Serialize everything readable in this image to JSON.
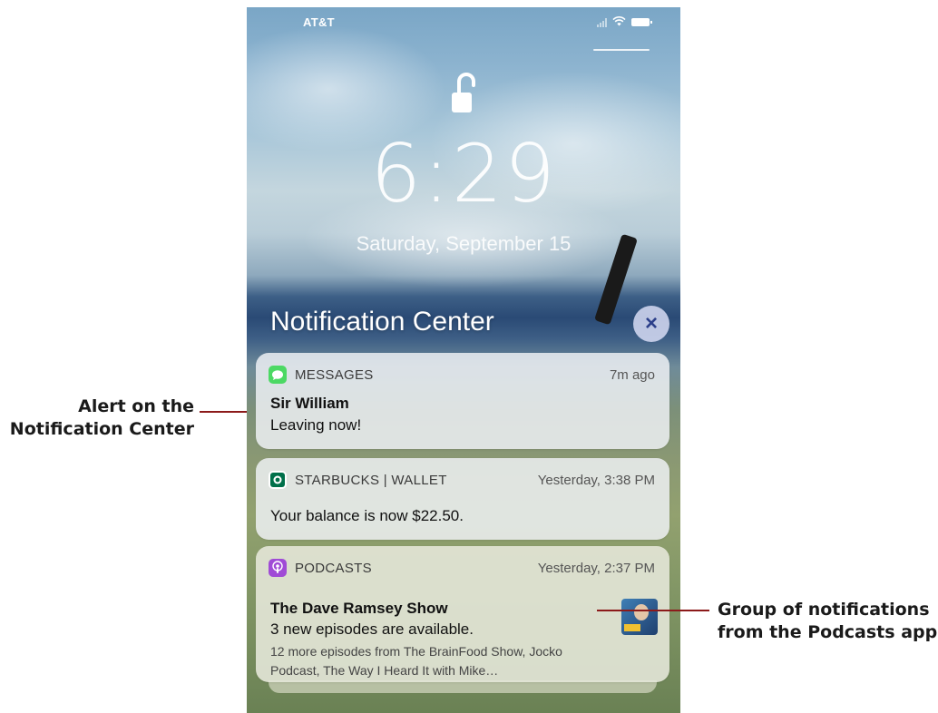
{
  "annotations": {
    "left": [
      "Alert on the",
      "Notification Center"
    ],
    "right": [
      "Group of notifications",
      "from the Podcasts app"
    ]
  },
  "status_bar": {
    "carrier": "AT&T"
  },
  "lock_screen": {
    "time": "6:29",
    "date": "Saturday, September 15"
  },
  "notification_center": {
    "title": "Notification Center",
    "close_glyph": "×",
    "notifications": [
      {
        "app": "MESSAGES",
        "icon": "messages-icon",
        "time": "7m ago",
        "title": "Sir William",
        "body": "Leaving now!"
      },
      {
        "app": "STARBUCKS | WALLET",
        "icon": "starbucks-icon",
        "time": "Yesterday, 3:38 PM",
        "body": "Your balance is now $22.50."
      },
      {
        "app": "PODCASTS",
        "icon": "podcasts-icon",
        "time": "Yesterday, 2:37 PM",
        "title": "The Dave Ramsey Show",
        "body": "3 new episodes are available.",
        "more": "12 more episodes from The BrainFood Show, Jocko Podcast, The Way I Heard It with Mike…"
      }
    ]
  },
  "colors": {
    "callout_line": "#8c1a1a",
    "messages_green": "#4cd964",
    "starbucks_green": "#00704a",
    "podcasts_purple": "#a04bd6"
  }
}
